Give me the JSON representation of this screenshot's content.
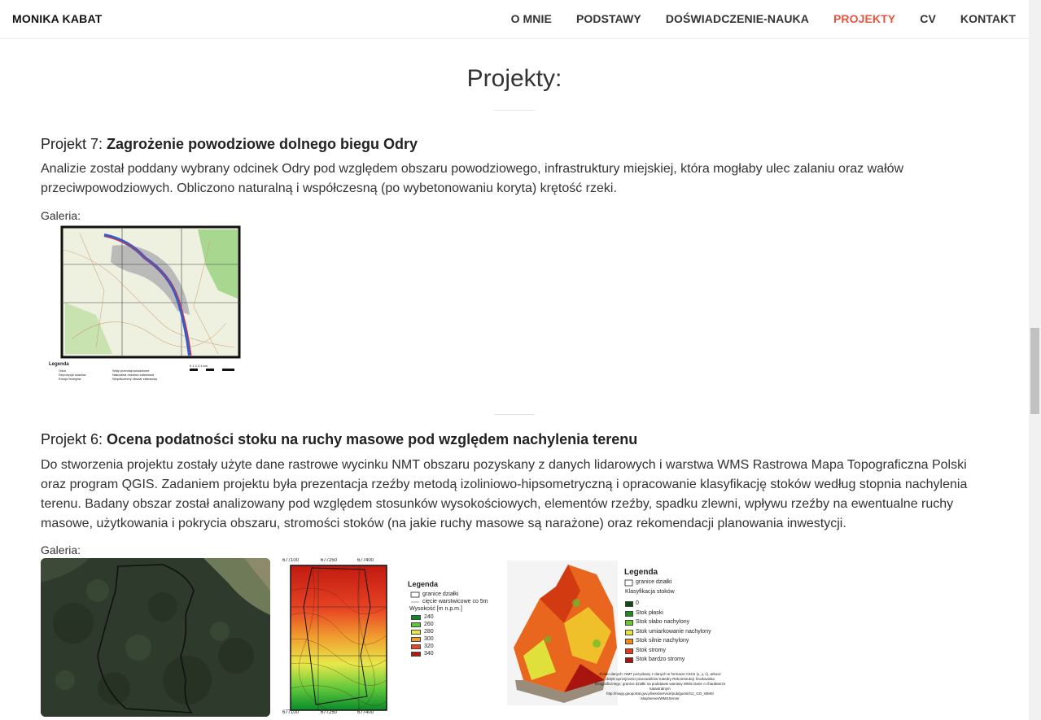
{
  "nav": {
    "brand": "MONIKA KABAT",
    "items": [
      {
        "label": "O MNIE",
        "active": false
      },
      {
        "label": "PODSTAWY",
        "active": false
      },
      {
        "label": "DOŚWIADCZENIE-NAUKA",
        "active": false
      },
      {
        "label": "PROJEKTY",
        "active": true
      },
      {
        "label": "CV",
        "active": false
      },
      {
        "label": "KONTAKT",
        "active": false
      }
    ],
    "active_color": "#e8553d"
  },
  "page": {
    "title": "Projekty:"
  },
  "projects": [
    {
      "prefix": "Projekt 7: ",
      "title": "Zagrożenie powodziowe dolnego biegu Odry",
      "description": "Analizie został poddany wybrany odcinek Odry pod względem obszaru powodziowego, infrastruktury miejskiej, która mogłaby ulec zalaniu oraz wałów przeciwpowodziowych. Obliczono naturalną i współczesną (po wybetonowaniu koryta) krętość rzeki.",
      "gallery_label": "Galeria:",
      "map_legend": {
        "title": "Legenda",
        "items": [
          "Odra",
          "Depozycja osadów",
          "Erozja brzegów",
          "Wały przeciwpowodziowe",
          "Naturalna równina zalewowa",
          "Współczesny obszar zalewowy"
        ],
        "scale": "0  1  2  3  4 km"
      }
    },
    {
      "prefix": "Projekt 6: ",
      "title": "Ocena podatności stoku na ruchy masowe pod względem nachylenia terenu",
      "description": "Do stworzenia projektu zostały użyte dane rastrowe wycinku NMT obszaru pozyskany z danych lidarowych i warstwa WMS Rastrowa Mapa Topograficzna Polski oraz program QGIS. Zadaniem projektu była prezentacja rzeźby metodą izoliniowo-hipsometryczną i opracowanie klasyfikację stoków według stopnia nachylenia terenu. Badany obszar został analizowany pod względem stosunków wysokościowych, elementów rzeźby, spadku zlewni, wpływu rzeźby na ewentualne ruchy masowe, użytkowania i pokrycia obszaru, stromości stoków (na jakie ruchy masowe są narażone) oraz rekomendacji planowania inwestycji.",
      "gallery_label": "Galeria:",
      "hypso_map": {
        "top_ticks": [
          "677100",
          "677250",
          "677400"
        ],
        "bottom_ticks": [
          "677100",
          "677250",
          "677400"
        ],
        "legend_title": "Legenda",
        "legend_items": [
          "granice działki",
          "cięcie warstwicowe co 5m"
        ],
        "height_title": "Wysokość [m n.p.m.]",
        "heights": [
          "240",
          "260",
          "280",
          "300",
          "320",
          "340"
        ],
        "height_colors": [
          "#0a8a2a",
          "#5fc83a",
          "#e8e84a",
          "#f0a030",
          "#e84424",
          "#b01a12"
        ]
      },
      "slope_map": {
        "legend_title": "Legenda",
        "legend_items": [
          "granice działki"
        ],
        "class_title": "Klasyfikacja stoków",
        "classes": [
          "0",
          "Stok płaski",
          "Stok słabo nachylony",
          "Stok umiarkowanie nachylony",
          "Stok silnie nachylony",
          "Stok stromy",
          "Stok bardzo stromy"
        ],
        "class_colors": [
          "#0b4d12",
          "#1f8a1f",
          "#69c92c",
          "#e6e63a",
          "#f08a1e",
          "#e03a1a",
          "#a8140e"
        ],
        "source": [
          "Źródło danych: NMT pozyskany z danych w formacie ASCII (x, y, z), arkusz",
          "dzięki uprzejmości pracowników Katedry Rekonstrukcji Środowiska",
          "Geograficznego; granice działki na podstawie warstwy WMS Dane o charakterze",
          "katastralnym",
          "http://mapy.geoportal.gov.pl/wss/service/pub/guest/G2_GO_WMS/",
          "MapServer/WMSServer"
        ]
      }
    }
  ]
}
